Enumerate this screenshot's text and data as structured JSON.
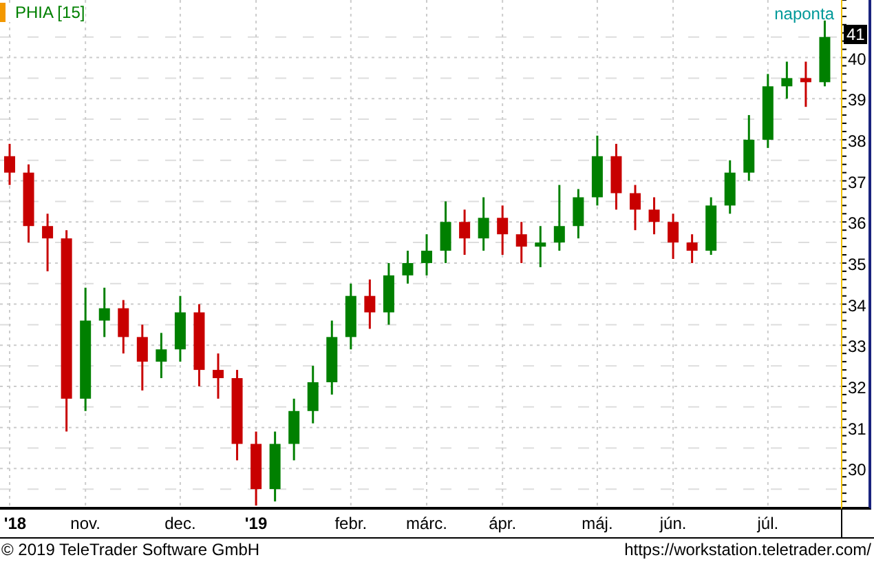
{
  "header": {
    "symbol": "PHIA [15]",
    "interval": "naponta"
  },
  "chart": {
    "chart_data": {
      "type": "candlestick",
      "categories": [
        "**'18**",
        null,
        null,
        null,
        "nov.",
        null,
        null,
        null,
        null,
        "dec.",
        null,
        null,
        null,
        "**'19**",
        null,
        null,
        null,
        null,
        "febr.",
        null,
        null,
        null,
        "márc.",
        null,
        null,
        null,
        "ápr.",
        null,
        null,
        null,
        null,
        "máj.",
        null,
        null,
        null,
        "jún.",
        null,
        null,
        null,
        null,
        "júl.",
        null,
        null,
        null
      ],
      "ohlc": [
        [
          37.6,
          37.9,
          36.9,
          37.2
        ],
        [
          37.2,
          37.4,
          35.5,
          35.9
        ],
        [
          35.9,
          36.2,
          34.8,
          35.6
        ],
        [
          35.6,
          35.8,
          30.9,
          31.7
        ],
        [
          31.7,
          34.4,
          31.4,
          33.6
        ],
        [
          33.6,
          34.4,
          33.2,
          33.9
        ],
        [
          33.9,
          34.1,
          32.8,
          33.2
        ],
        [
          33.2,
          33.5,
          31.9,
          32.6
        ],
        [
          32.6,
          33.3,
          32.2,
          32.9
        ],
        [
          32.9,
          34.2,
          32.6,
          33.8
        ],
        [
          33.8,
          34.0,
          32.0,
          32.4
        ],
        [
          32.4,
          32.8,
          31.7,
          32.2
        ],
        [
          32.2,
          32.4,
          30.2,
          30.6
        ],
        [
          30.6,
          30.9,
          29.1,
          29.5
        ],
        [
          29.5,
          30.9,
          29.2,
          30.6
        ],
        [
          30.6,
          31.7,
          30.2,
          31.4
        ],
        [
          31.4,
          32.5,
          31.1,
          32.1
        ],
        [
          32.1,
          33.6,
          31.8,
          33.2
        ],
        [
          33.2,
          34.5,
          32.9,
          34.2
        ],
        [
          34.2,
          34.6,
          33.4,
          33.8
        ],
        [
          33.8,
          35.0,
          33.5,
          34.7
        ],
        [
          34.7,
          35.3,
          34.5,
          35.0
        ],
        [
          35.0,
          35.7,
          34.7,
          35.3
        ],
        [
          35.3,
          36.5,
          35.0,
          36.0
        ],
        [
          36.0,
          36.3,
          35.2,
          35.6
        ],
        [
          35.6,
          36.6,
          35.3,
          36.1
        ],
        [
          36.1,
          36.4,
          35.2,
          35.7
        ],
        [
          35.7,
          36.0,
          35.0,
          35.4
        ],
        [
          35.4,
          35.9,
          34.9,
          35.5
        ],
        [
          35.5,
          36.9,
          35.3,
          35.9
        ],
        [
          35.9,
          36.8,
          35.6,
          36.6
        ],
        [
          36.6,
          38.1,
          36.4,
          37.6
        ],
        [
          37.6,
          37.9,
          36.3,
          36.7
        ],
        [
          36.7,
          36.9,
          35.8,
          36.3
        ],
        [
          36.3,
          36.6,
          35.7,
          36.0
        ],
        [
          36.0,
          36.2,
          35.1,
          35.5
        ],
        [
          35.5,
          35.7,
          35.0,
          35.3
        ],
        [
          35.3,
          36.6,
          35.2,
          36.4
        ],
        [
          36.4,
          37.5,
          36.2,
          37.2
        ],
        [
          37.2,
          38.6,
          37.0,
          38.0
        ],
        [
          38.0,
          39.6,
          37.8,
          39.3
        ],
        [
          39.3,
          39.9,
          39.0,
          39.5
        ],
        [
          39.5,
          39.9,
          38.8,
          39.4
        ],
        [
          39.4,
          40.9,
          39.3,
          40.5
        ]
      ],
      "ylim": [
        29,
        41.4
      ],
      "grid": true,
      "yticks": [
        30,
        31,
        32,
        33,
        34,
        35,
        36,
        37,
        38,
        39,
        40
      ]
    },
    "last_price_label": "41"
  },
  "footer": {
    "copyright": "© 2019 TeleTrader Software GmbH",
    "url": "https://workstation.teletrader.com/"
  }
}
